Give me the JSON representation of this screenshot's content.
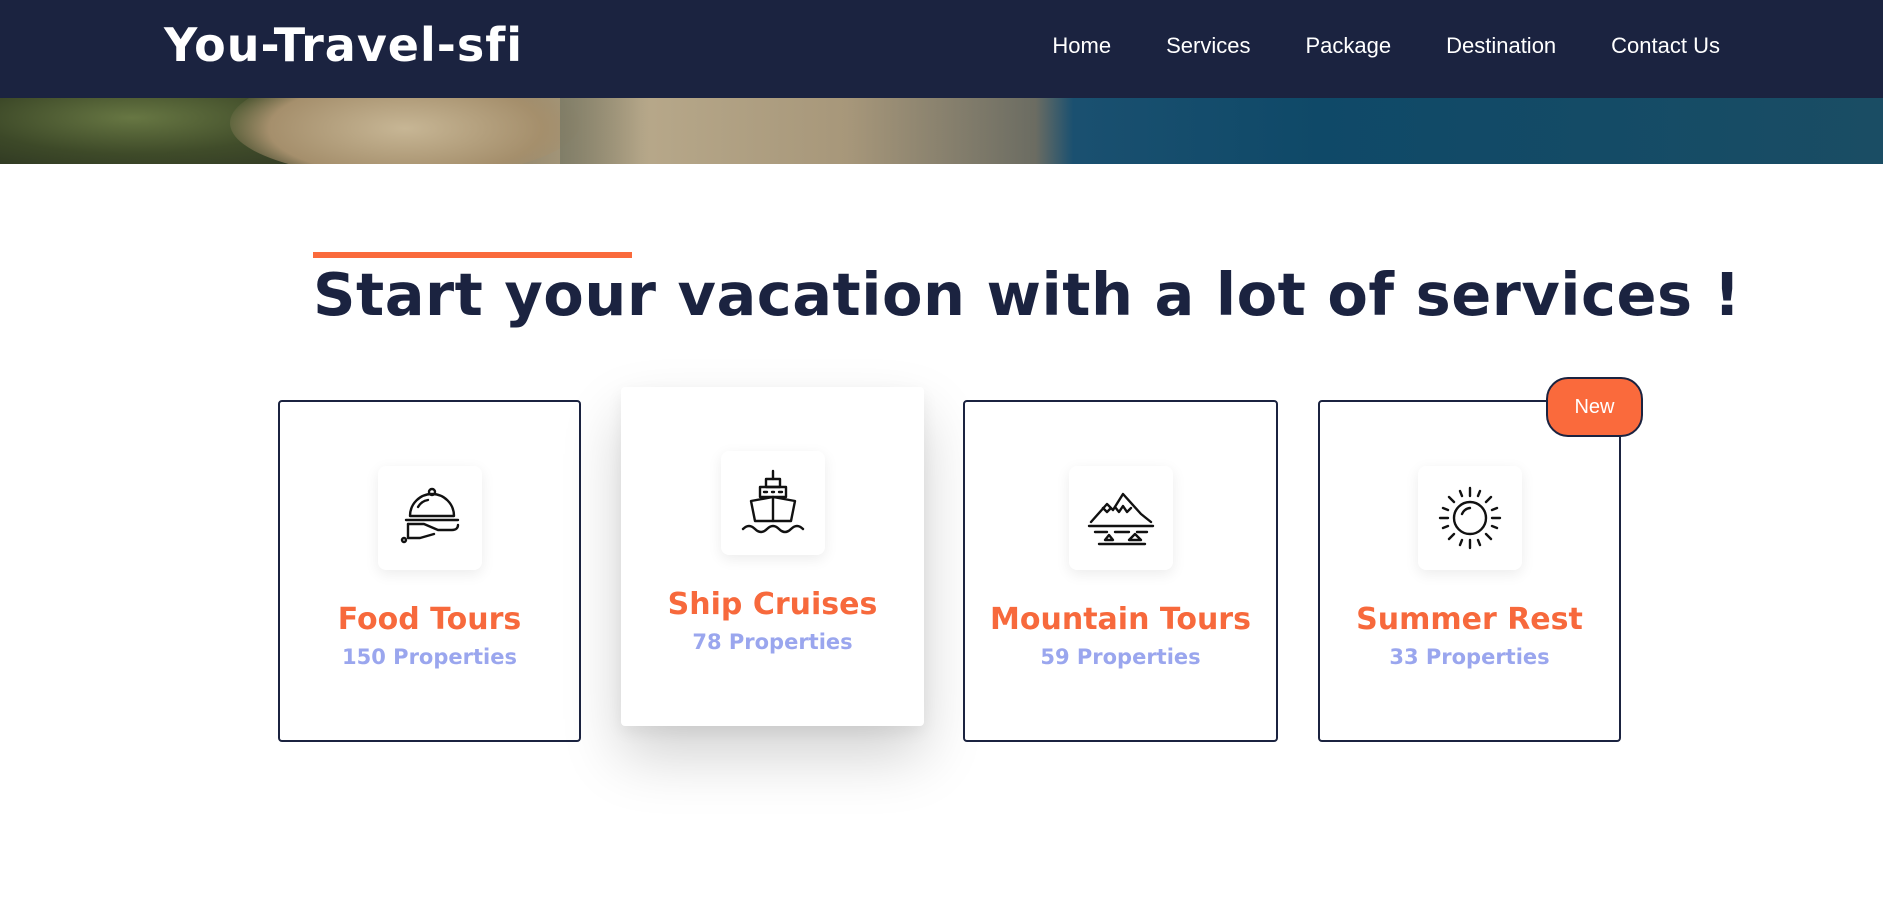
{
  "header": {
    "brand": "You-Travel-sfi",
    "nav": [
      {
        "label": "Home"
      },
      {
        "label": "Services"
      },
      {
        "label": "Package"
      },
      {
        "label": "Destination"
      },
      {
        "label": "Contact Us"
      }
    ]
  },
  "section": {
    "title": "Start your vacation with a lot of services !",
    "accent_color": "#fa6a3c"
  },
  "cards": [
    {
      "title": "Food Tours",
      "count": "150 Properties",
      "icon": "food-cloche-icon"
    },
    {
      "title": "Ship Cruises",
      "count": "78 Properties",
      "icon": "ship-icon"
    },
    {
      "title": "Mountain Tours",
      "count": "59 Properties",
      "icon": "mountain-icon"
    },
    {
      "title": "Summer Rest",
      "count": "33 Properties",
      "icon": "sun-icon",
      "badge": "New"
    }
  ],
  "colors": {
    "navy": "#1b2340",
    "orange": "#f7693c",
    "lavender": "#9aa6ee"
  }
}
